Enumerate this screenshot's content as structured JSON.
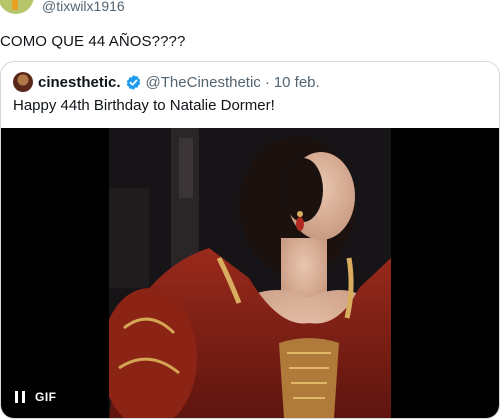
{
  "tweet": {
    "handle": "@tixwilx1916",
    "text": "COMO QUE 44 AÑOS????"
  },
  "quote": {
    "name": "cinesthetic.",
    "handle": "@TheCinesthetic",
    "separator": "·",
    "date": "10 feb.",
    "text": "Happy 44th Birthday to Natalie Dormer!"
  },
  "media": {
    "gif_label": "GIF",
    "pause_icon": "pause-icon"
  },
  "colors": {
    "text": "#0f1419",
    "muted": "#536471",
    "verified": "#1d9bf0",
    "border": "#cfd9de"
  }
}
